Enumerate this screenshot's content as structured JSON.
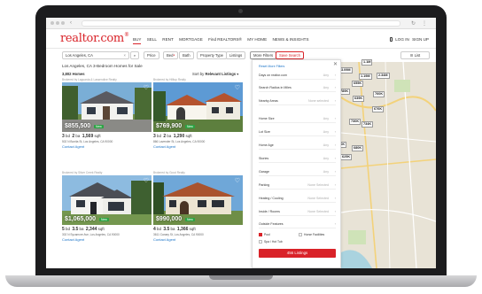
{
  "header": {
    "logo_text": "realtor",
    "logo_suffix": ".com",
    "logo_reg": "®",
    "nav": [
      "BUY",
      "SELL",
      "RENT",
      "MORTGAGE",
      "Find REALTORS®",
      "MY HOME",
      "NEWS & INSIGHTS"
    ],
    "login": "LOG IN",
    "signup": "SIGN UP"
  },
  "filters": {
    "search_value": "Los Angeles, CA",
    "price": "Price",
    "beds": "Bed",
    "bath": "Bath",
    "property_type": "Property Type",
    "listings": "Listings",
    "more_filters": "More Filters",
    "save_search": "Save Search",
    "list_toggle": "List"
  },
  "results": {
    "title": "Los Angeles, CA 3-Bedroom Homes for Sale",
    "count": "3,802 Homes",
    "sort_label": "Sort by",
    "sort_value": "Relevant Listings"
  },
  "cards": [
    {
      "brokered": "Brokered by Laguarda & Lassendine Realty",
      "price": "$855,500",
      "new": "New",
      "beds": "3",
      "baths": "2",
      "sqft": "1,569",
      "address": "502 N Bonita St, Los Angeles, CA 90000",
      "agent": "Contact Agent"
    },
    {
      "brokered": "Brokered by Hilltop Realty",
      "price": "$769,900",
      "new": "New",
      "beds": "3",
      "baths": "2",
      "sqft": "1,290",
      "address": "866 Lavender St, Los Angeles, CA 90000",
      "agent": "Contact Agent"
    },
    {
      "brokered": "Brokered by Silver Creek Realty",
      "price": "$1,065,000",
      "new": "New",
      "beds": "5",
      "baths": "3.5",
      "sqft": "2,344",
      "address": "302 N Sycamore Ave, Los Angeles, CA 90000",
      "agent": "Contact Agent"
    },
    {
      "brokered": "Brokered by Good Realty",
      "price": "$990,000",
      "new": "New",
      "beds": "4",
      "baths": "3.5",
      "sqft": "1,366",
      "address": "3611 Canary St, Los Angeles, CA 90000",
      "agent": "Contact Agent"
    }
  ],
  "card_units": {
    "bd": "bd",
    "ba": "ba",
    "sqft": "sqft"
  },
  "panel": {
    "reset": "Reset More Filters",
    "rows": [
      {
        "label": "Days on realtor.com",
        "value": "Any"
      },
      {
        "label": "Search Radius in Miles",
        "value": "Any"
      },
      {
        "label": "Nearby Areas",
        "value": "None selected"
      },
      {
        "label": "Home Size",
        "value": "Any"
      },
      {
        "label": "Lot Size",
        "value": "Any"
      },
      {
        "label": "Home Age",
        "value": "Any"
      },
      {
        "label": "Stories",
        "value": "Any"
      },
      {
        "label": "Garage",
        "value": "Any"
      },
      {
        "label": "Parking",
        "value": "None Selected"
      },
      {
        "label": "Heating / Cooling",
        "value": "None Selected"
      },
      {
        "label": "Inside / Rooms",
        "value": "None Selected"
      },
      {
        "label": "Outside Features",
        "value": ""
      }
    ],
    "checks": {
      "pool": "Pool",
      "horse": "Horse Facilities",
      "spa": "Spa / Hot Tub"
    },
    "button": "456 Listings"
  },
  "map_prices": [
    "3.09M",
    "1.1M",
    "1.19M",
    "2.34M",
    "922K",
    "655K",
    "760K",
    "890K",
    "789K",
    "639K",
    "676K",
    "730K",
    "734K",
    "38K",
    "767K",
    "750K",
    "680K",
    "633K",
    "625K"
  ],
  "colors": {
    "brand": "#d92228",
    "link": "#1a73c7",
    "new_badge": "#2ba343"
  }
}
